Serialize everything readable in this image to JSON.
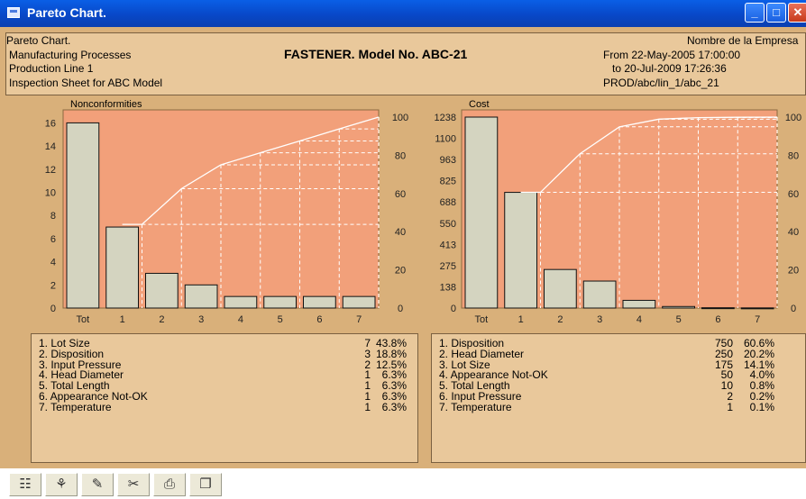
{
  "window": {
    "title": "Pareto Chart."
  },
  "header": {
    "line1": "Pareto Chart.",
    "line2": "Manufacturing Processes",
    "line3": "Production Line 1",
    "line4": "Inspection Sheet for ABC Model",
    "center_title": "FASTENER. Model No. ABC-21",
    "company": "Nombre de la Empresa",
    "from": "From  22-May-2005  17:00:00",
    "to": "to  20-Jul-2009  17:26:36",
    "path": "PROD/abc/lin_1/abc_21"
  },
  "colors": {
    "plot_bg": "#f2a07a",
    "bar_fill": "#d4d4c0",
    "frame": "#d9b07a",
    "panel": "#e9c89b"
  },
  "chart_data": [
    {
      "type": "bar",
      "title": "Nonconformities",
      "categories": [
        "Tot",
        "1",
        "2",
        "3",
        "4",
        "5",
        "6",
        "7"
      ],
      "values": [
        16,
        7,
        3,
        2,
        1,
        1,
        1,
        1
      ],
      "left_ticks": [
        "0",
        "2",
        "4",
        "6",
        "8",
        "10",
        "12",
        "14",
        "16"
      ],
      "left_range": [
        0,
        16.5
      ],
      "right_ticks": [
        "0",
        "20",
        "40",
        "60",
        "80",
        "100"
      ],
      "cumulative_percent": [
        43.8,
        62.5,
        75.0,
        81.3,
        87.5,
        93.8,
        100.0
      ],
      "table": [
        {
          "label": "1. Lot Size",
          "count": "7",
          "pct": "43.8%"
        },
        {
          "label": "2. Disposition",
          "count": "3",
          "pct": "18.8%"
        },
        {
          "label": "3. Input Pressure",
          "count": "2",
          "pct": "12.5%"
        },
        {
          "label": "4. Head Diameter",
          "count": "1",
          "pct": "6.3%"
        },
        {
          "label": "5. Total Length",
          "count": "1",
          "pct": "6.3%"
        },
        {
          "label": "6. Appearance Not-OK",
          "count": "1",
          "pct": "6.3%"
        },
        {
          "label": "7. Temperature",
          "count": "1",
          "pct": "6.3%"
        }
      ]
    },
    {
      "type": "bar",
      "title": "Cost",
      "categories": [
        "Tot",
        "1",
        "2",
        "3",
        "4",
        "5",
        "6",
        "7"
      ],
      "values": [
        1238,
        750,
        250,
        175,
        50,
        10,
        2,
        1
      ],
      "left_ticks": [
        "0",
        "138",
        "275",
        "413",
        "550",
        "688",
        "825",
        "963",
        "1100",
        "1238"
      ],
      "left_range": [
        0,
        1238
      ],
      "right_ticks": [
        "0",
        "20",
        "40",
        "60",
        "80",
        "100"
      ],
      "cumulative_percent": [
        60.6,
        80.8,
        94.9,
        98.9,
        99.7,
        99.9,
        100.0
      ],
      "table": [
        {
          "label": "1. Disposition",
          "count": "750",
          "pct": "60.6%"
        },
        {
          "label": "2. Head Diameter",
          "count": "250",
          "pct": "20.2%"
        },
        {
          "label": "3. Lot Size",
          "count": "175",
          "pct": "14.1%"
        },
        {
          "label": "4. Appearance Not-OK",
          "count": "50",
          "pct": "4.0%"
        },
        {
          "label": "5. Total Length",
          "count": "10",
          "pct": "0.8%"
        },
        {
          "label": "6. Input Pressure",
          "count": "2",
          "pct": "0.2%"
        },
        {
          "label": "7. Temperature",
          "count": "1",
          "pct": "0.1%"
        }
      ]
    }
  ],
  "toolbar": {
    "buttons": [
      {
        "name": "properties-button",
        "icon": "properties-icon",
        "glyph": "☷"
      },
      {
        "name": "filter-button",
        "icon": "filter-icon",
        "glyph": "⚘"
      },
      {
        "name": "edit-button",
        "icon": "pen-icon",
        "glyph": "✎"
      },
      {
        "name": "tools-button",
        "icon": "tools-icon",
        "glyph": "✂"
      },
      {
        "name": "print-button",
        "icon": "printer-icon",
        "glyph": "⎙"
      },
      {
        "name": "copy-button",
        "icon": "copy-icon",
        "glyph": "❐"
      }
    ]
  }
}
